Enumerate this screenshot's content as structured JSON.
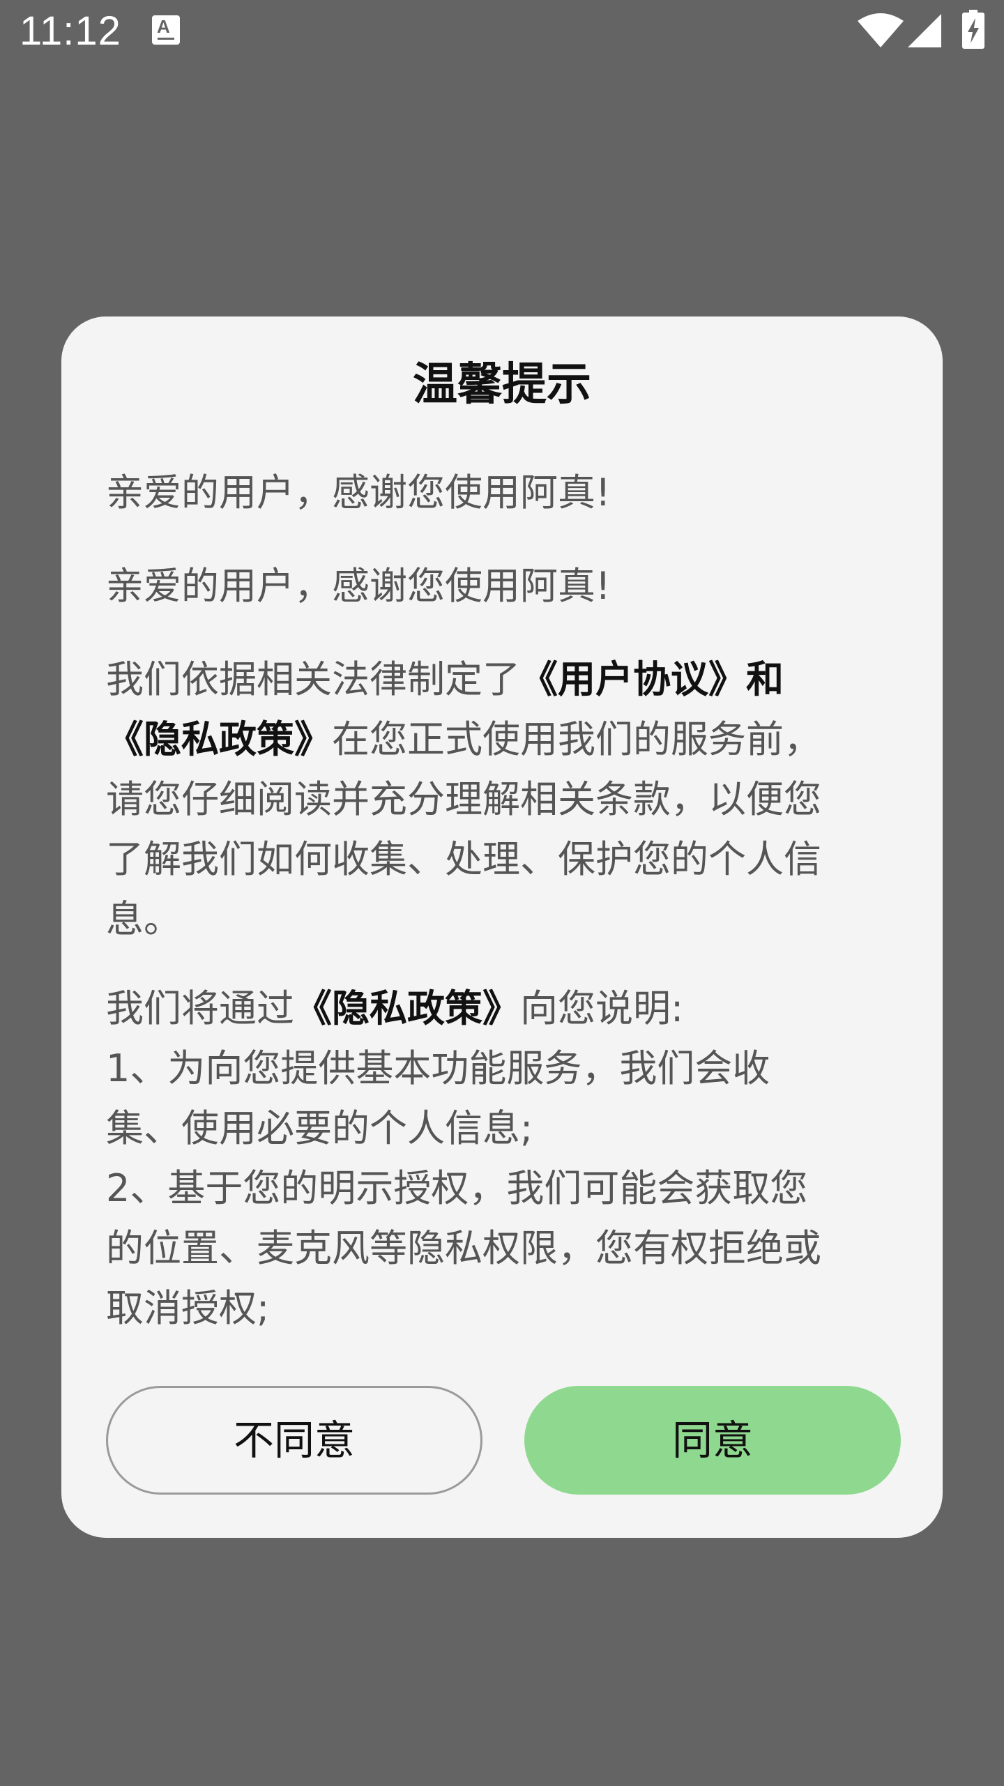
{
  "status_bar": {
    "time": "11:12",
    "notification_glyph": "A",
    "icons": [
      "notification-icon",
      "wifi-icon",
      "signal-icon",
      "battery-charging-icon"
    ]
  },
  "dialog": {
    "title": "温馨提示",
    "greeting_1": "亲爱的用户，感谢您使用阿真!",
    "greeting_2": "亲爱的用户，感谢您使用阿真!",
    "para_1": {
      "lead": "我们依据相关法律制定了",
      "user_agreement": "《用户协议》",
      "conj": "和",
      "privacy_policy": "《隐私政策》",
      "rest_1": "在您正式使用我们的服务前，",
      "rest_2": "请您仔细阅读并充分理解相关条款，以便您",
      "rest_3": "了解我们如何收集、处理、保护您的个人信",
      "rest_4": "息。"
    },
    "para_2": {
      "lead": "我们将通过",
      "privacy_policy": "《隐私政策》",
      "lead_end": "向您说明:",
      "item_1_a": "1、为向您提供基本功能服务，我们会收",
      "item_1_b": "集、使用必要的个人信息;",
      "item_2_a": "2、基于您的明示授权，我们可能会获取您",
      "item_2_b": "的位置、麦克风等隐私权限，您有权拒绝或",
      "item_2_c": "取消授权;"
    },
    "decline_label": "不同意",
    "agree_label": "同意"
  },
  "colors": {
    "scrim": "#646464",
    "dialog_bg": "#f4f4f4",
    "agree_button": "#8fd88f",
    "decline_border": "#9a9a9a",
    "body_text": "#555555",
    "emphasis_text": "#111111"
  }
}
